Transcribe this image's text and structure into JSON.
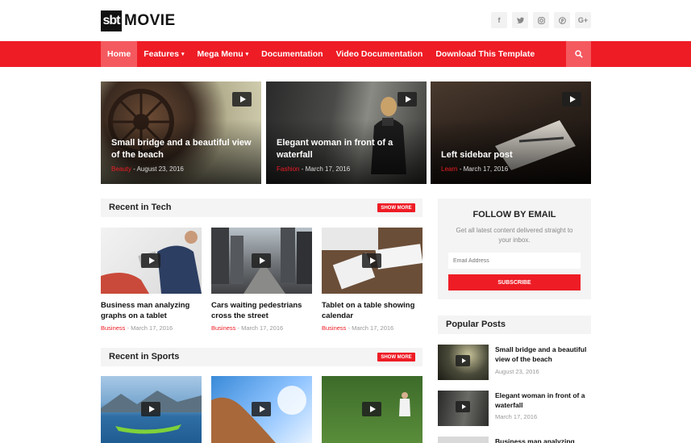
{
  "header": {
    "logo_box": "sbt",
    "logo_text": "MOVIE",
    "socials": [
      "f",
      "t",
      "ig",
      "p",
      "G+"
    ]
  },
  "nav": {
    "items": [
      {
        "label": "Home",
        "caret": ""
      },
      {
        "label": "Features",
        "caret": "▾"
      },
      {
        "label": "Mega Menu",
        "caret": "▾"
      },
      {
        "label": "Documentation",
        "caret": ""
      },
      {
        "label": "Video Documentation",
        "caret": ""
      },
      {
        "label": "Download This Template",
        "caret": ""
      }
    ],
    "search_icon": "search-icon"
  },
  "featured": [
    {
      "title": "Small bridge and a beautiful view of the beach",
      "category": "Beauty",
      "date": "August 23, 2016"
    },
    {
      "title": "Elegant woman in front of a waterfall",
      "category": "Fashion",
      "date": "March 17, 2016"
    },
    {
      "title": "Left sidebar post",
      "category": "Learn",
      "date": "March 17, 2016"
    }
  ],
  "tech": {
    "heading": "Recent in Tech",
    "show_more": "SHOW MORE",
    "posts": [
      {
        "title": "Business man analyzing graphs on a tablet",
        "category": "Business",
        "date": "March 17, 2016"
      },
      {
        "title": "Cars waiting pedestrians cross the street",
        "category": "Business",
        "date": "March 17, 2016"
      },
      {
        "title": "Tablet on a table showing calendar",
        "category": "Business",
        "date": "March 17, 2016"
      }
    ]
  },
  "sports": {
    "heading": "Recent in Sports",
    "show_more": "SHOW MORE"
  },
  "follow": {
    "heading": "FOLLOW BY EMAIL",
    "text": "Get all latest content delivered straight to your inbox.",
    "placeholder": "Email Address",
    "button": "SUBSCRIBE"
  },
  "popular": {
    "heading": "Popular Posts",
    "posts": [
      {
        "title": "Small bridge and a beautiful view of the beach",
        "date": "August 23, 2016"
      },
      {
        "title": "Elegant woman in front of a waterfall",
        "date": "March 17, 2016"
      },
      {
        "title": "Business man analyzing",
        "date": ""
      }
    ]
  },
  "separator": " - "
}
